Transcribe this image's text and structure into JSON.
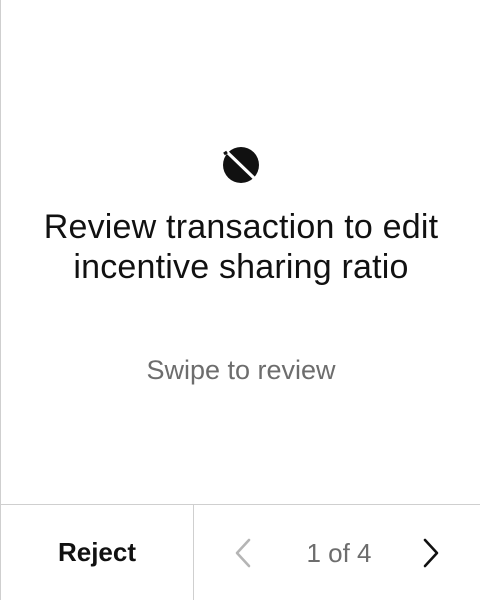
{
  "review": {
    "logo_icon": "app-logo-icon",
    "title": "Review transaction to edit incentive sharing ratio",
    "subtitle": "Swipe to review"
  },
  "footer": {
    "reject_label": "Reject",
    "prev_icon": "chevron-left-icon",
    "next_icon": "chevron-right-icon",
    "page_indicator": "1 of 4",
    "current_page": 1,
    "total_pages": 4,
    "prev_enabled": false,
    "next_enabled": true
  },
  "colors": {
    "text_primary": "#111111",
    "text_secondary": "#6d6d6d",
    "divider": "#cfcfcf",
    "disabled_icon": "#b5b5b5",
    "background": "#ffffff"
  }
}
